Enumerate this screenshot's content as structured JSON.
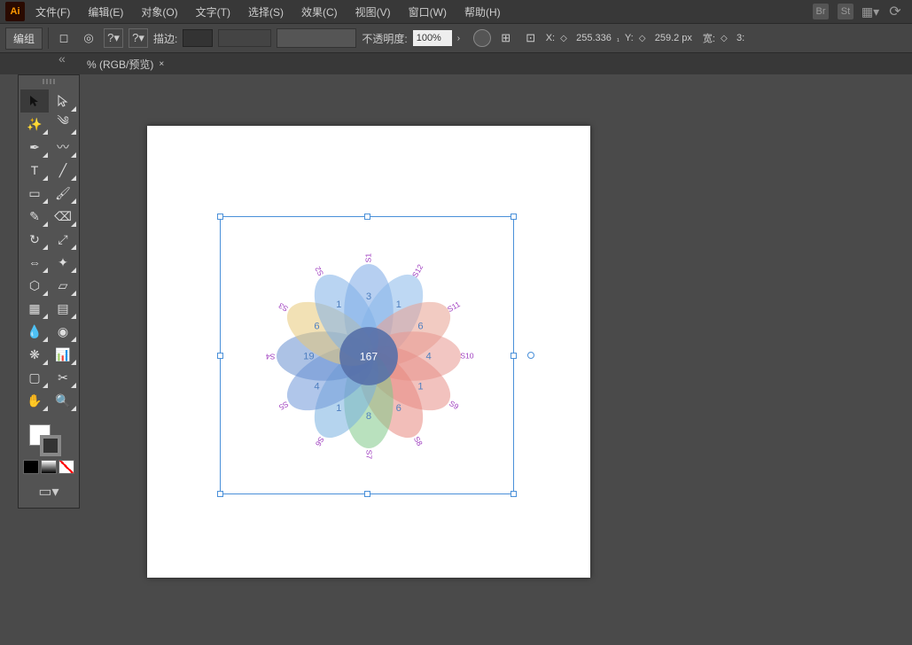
{
  "app": {
    "logo": "Ai"
  },
  "menu": {
    "file": "文件(F)",
    "edit": "编辑(E)",
    "object": "对象(O)",
    "type": "文字(T)",
    "select": "选择(S)",
    "effect": "效果(C)",
    "view": "视图(V)",
    "window": "窗口(W)",
    "help": "帮助(H)"
  },
  "right_icons": {
    "br": "Br",
    "st": "St"
  },
  "control": {
    "group_label": "编组",
    "stroke_label": "描边:",
    "opacity_label": "不透明度:",
    "opacity_value": "100%",
    "x_label": "X:",
    "x_value": "255.336",
    "x_unit": "₁",
    "y_label": "Y:",
    "y_value": "259.2 px",
    "w_label": "宽:",
    "w_value": "3:"
  },
  "document": {
    "tab_title": "% (RGB/预览)",
    "close": "×"
  },
  "chart_data": {
    "type": "flower-venn",
    "center_value": 167,
    "petals": [
      {
        "label": "S1",
        "value": 3,
        "angle": -90
      },
      {
        "label": "S12",
        "value": 1,
        "angle": -60
      },
      {
        "label": "S11",
        "value": 6,
        "angle": -30
      },
      {
        "label": "S10",
        "value": 4,
        "angle": 0
      },
      {
        "label": "S9",
        "value": 1,
        "angle": 30
      },
      {
        "label": "S8",
        "value": 6,
        "angle": 60
      },
      {
        "label": "S7",
        "value": 8,
        "angle": 90
      },
      {
        "label": "S6",
        "value": 1,
        "angle": 120
      },
      {
        "label": "S5",
        "value": 4,
        "angle": 150
      },
      {
        "label": "S4",
        "value": 19,
        "angle": 180
      },
      {
        "label": "S3",
        "value": 6,
        "angle": 210
      },
      {
        "label": "S2",
        "value": 1,
        "angle": 240
      }
    ],
    "petal_colors": [
      "#7aa8e6",
      "#88b8ea",
      "#e8a090",
      "#e89890",
      "#e89088",
      "#e88880",
      "#80c888",
      "#78b0e0",
      "#7098d8",
      "#6890d0",
      "#e8c878",
      "#80b0e8"
    ]
  }
}
